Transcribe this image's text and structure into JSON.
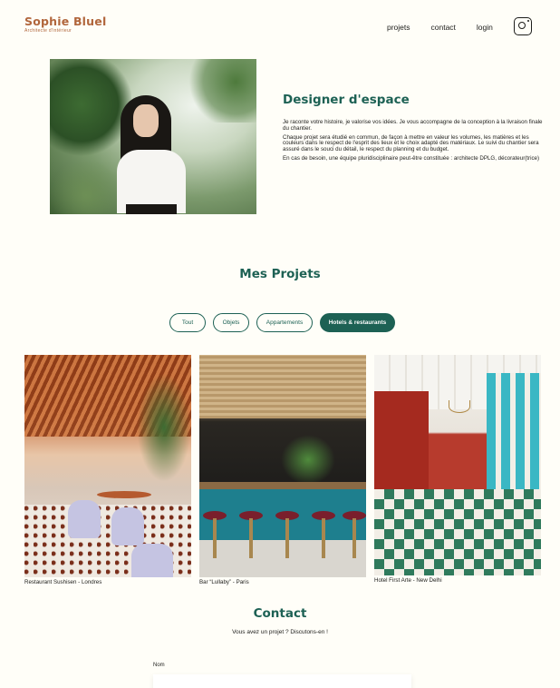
{
  "header": {
    "logo_title": "Sophie Bluel",
    "logo_subtitle": "Architecte d'intérieur",
    "nav": [
      "projets",
      "contact",
      "login"
    ],
    "instagram_icon": "instagram-icon"
  },
  "intro": {
    "title": "Designer d'espace",
    "paragraphs": [
      "Je raconte votre histoire, je valorise vos idées. Je vous accompagne de la conception à la livraison finale du chantier.",
      "Chaque projet sera étudié en commun, de façon à mettre en valeur les volumes, les matières et les couleurs dans le respect de l'esprit des lieux et le choix adapté des matériaux. Le suivi du chantier sera assuré dans le souci du détail, le respect du planning et du budget.",
      "En cas de besoin, une équipe pluridisciplinaire peut-être constituée : architecte DPLG, décorateur(trice)"
    ]
  },
  "projects": {
    "title": "Mes Projets",
    "filters": [
      {
        "label": "Tout",
        "active": false
      },
      {
        "label": "Objets",
        "active": false
      },
      {
        "label": "Appartements",
        "active": false
      },
      {
        "label": "Hotels & restaurants",
        "active": true
      }
    ],
    "items": [
      {
        "caption": "Restaurant Sushisen - Londres"
      },
      {
        "caption": "Bar “Lullaby” - Paris"
      },
      {
        "caption": "Hotel First Arte - New Delhi"
      }
    ]
  },
  "contact": {
    "title": "Contact",
    "subtitle": "Vous avez un projet ? Discutons-en !",
    "name_label": "Nom",
    "name_value": ""
  },
  "colors": {
    "brand": "#b1663c",
    "accent": "#1d6154",
    "background": "#fffef8"
  }
}
